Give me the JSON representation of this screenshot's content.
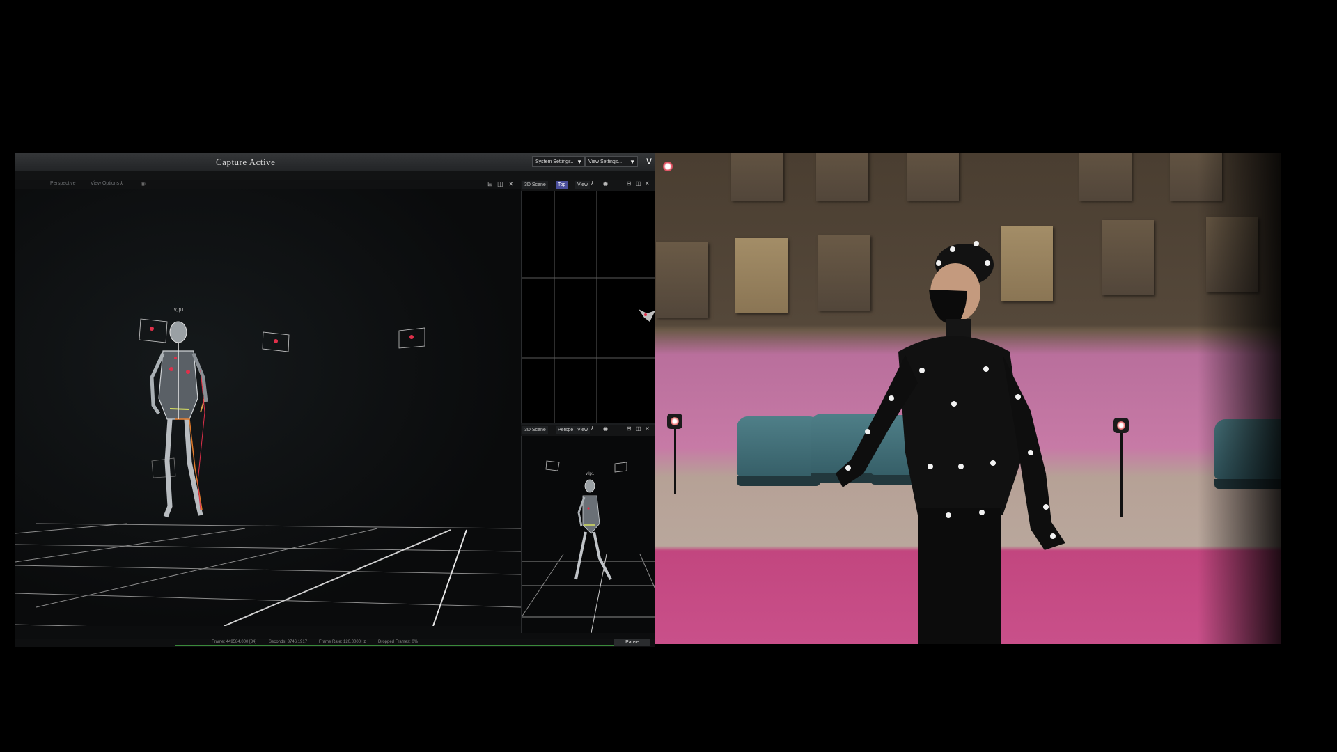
{
  "app": {
    "title": "Capture Active",
    "system_settings": "System Settings...",
    "view_settings": "View Settings...",
    "dropdown_arrow": "▼",
    "logo": "V"
  },
  "main_toolbar": {
    "view_label": "Perspective",
    "view_options": "View Options"
  },
  "subject_label": "v,lp1",
  "sub_view_top": {
    "scene": "3D Scene",
    "view": "Top",
    "view_menu": "View"
  },
  "sub_view_bottom": {
    "scene": "3D Scene",
    "view": "Perspe",
    "view_menu": "View"
  },
  "status": {
    "frame": "Frame: 449584.000 [34]",
    "seconds": "Seconds: 3746.1917",
    "frame_rate": "Frame Rate: 120.0000Hz",
    "dropped": "Dropped Frames: 0%",
    "pause": "Pause"
  },
  "colors": {
    "accent_tab": "#4b4f9c",
    "grid_line": "#8c8c8c",
    "marker_red": "#e0304a",
    "floor_carpet": "#c9508a",
    "wall_pink": "#c77aa6"
  }
}
